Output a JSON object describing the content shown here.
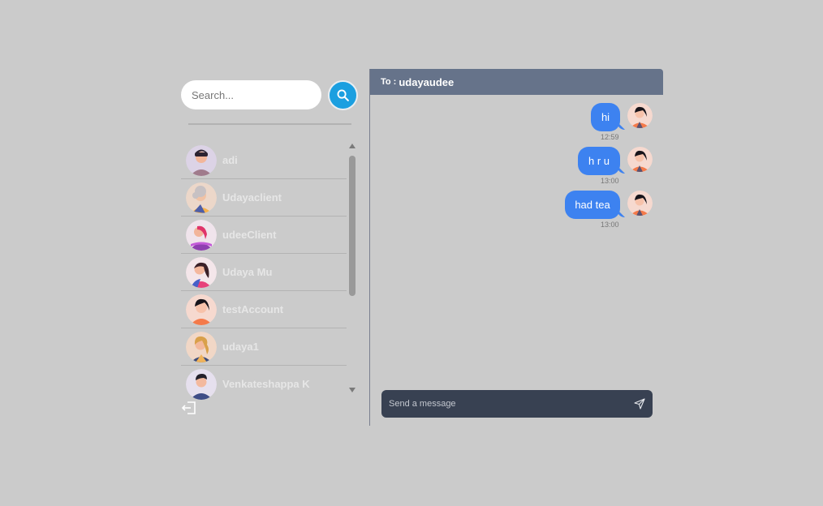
{
  "search": {
    "placeholder": "Search..."
  },
  "contacts": [
    {
      "name": "adi"
    },
    {
      "name": "Udayaclient"
    },
    {
      "name": "udeeClient"
    },
    {
      "name": "Udaya Mu"
    },
    {
      "name": "testAccount"
    },
    {
      "name": "udaya1"
    },
    {
      "name": "Venkateshappa K"
    }
  ],
  "chat": {
    "to_label": "To :",
    "recipient": "udayaudee",
    "messages": [
      {
        "text": "hi",
        "time": "12:59"
      },
      {
        "text": "h r u",
        "time": "13:00"
      },
      {
        "text": "had tea",
        "time": "13:00"
      }
    ],
    "composer_placeholder": "Send a message"
  },
  "colors": {
    "background": "#cbcbcb",
    "accent": "#1b9fe0",
    "bubble": "#3d82f0",
    "header": "#66738a",
    "composer": "#384152"
  },
  "icons": {
    "search": "search-icon",
    "logout": "logout-icon",
    "send": "send-icon"
  }
}
